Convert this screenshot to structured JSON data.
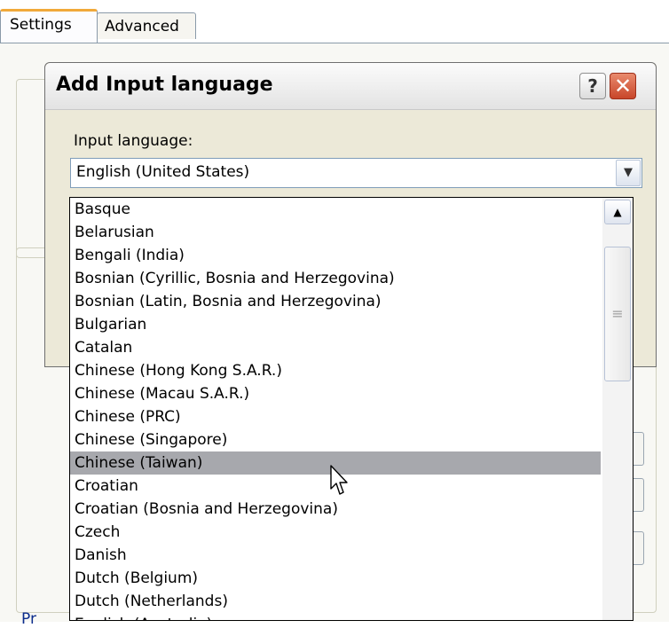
{
  "tabs": [
    {
      "label": "Settings"
    },
    {
      "label": "Advanced"
    }
  ],
  "dialog": {
    "title": "Add Input language",
    "help_glyph": "?",
    "close_glyph": "✕",
    "input_language_label": "Input language:",
    "selected_value": "English (United States)",
    "dropdown_arrow": "▼",
    "scroll_up_arrow": "▲",
    "thumb_grip": "≡"
  },
  "languages": [
    {
      "label": "Basque"
    },
    {
      "label": "Belarusian"
    },
    {
      "label": "Bengali (India)"
    },
    {
      "label": "Bosnian (Cyrillic, Bosnia and Herzegovina)"
    },
    {
      "label": "Bosnian (Latin, Bosnia and Herzegovina)"
    },
    {
      "label": "Bulgarian"
    },
    {
      "label": "Catalan"
    },
    {
      "label": "Chinese (Hong Kong S.A.R.)"
    },
    {
      "label": "Chinese (Macau S.A.R.)"
    },
    {
      "label": "Chinese (PRC)"
    },
    {
      "label": "Chinese (Singapore)"
    },
    {
      "label": "Chinese (Taiwan)",
      "selected": true
    },
    {
      "label": "Croatian"
    },
    {
      "label": "Croatian (Bosnia and Herzegovina)"
    },
    {
      "label": "Czech"
    },
    {
      "label": "Danish"
    },
    {
      "label": "Dutch (Belgium)"
    },
    {
      "label": "Dutch (Netherlands)"
    },
    {
      "label": "English (Australia)"
    }
  ],
  "background_text": "Pr",
  "colors": {
    "tab_accent": "#f1a93a",
    "selection": "#a7a8ad",
    "close_button": "#c8462a"
  }
}
